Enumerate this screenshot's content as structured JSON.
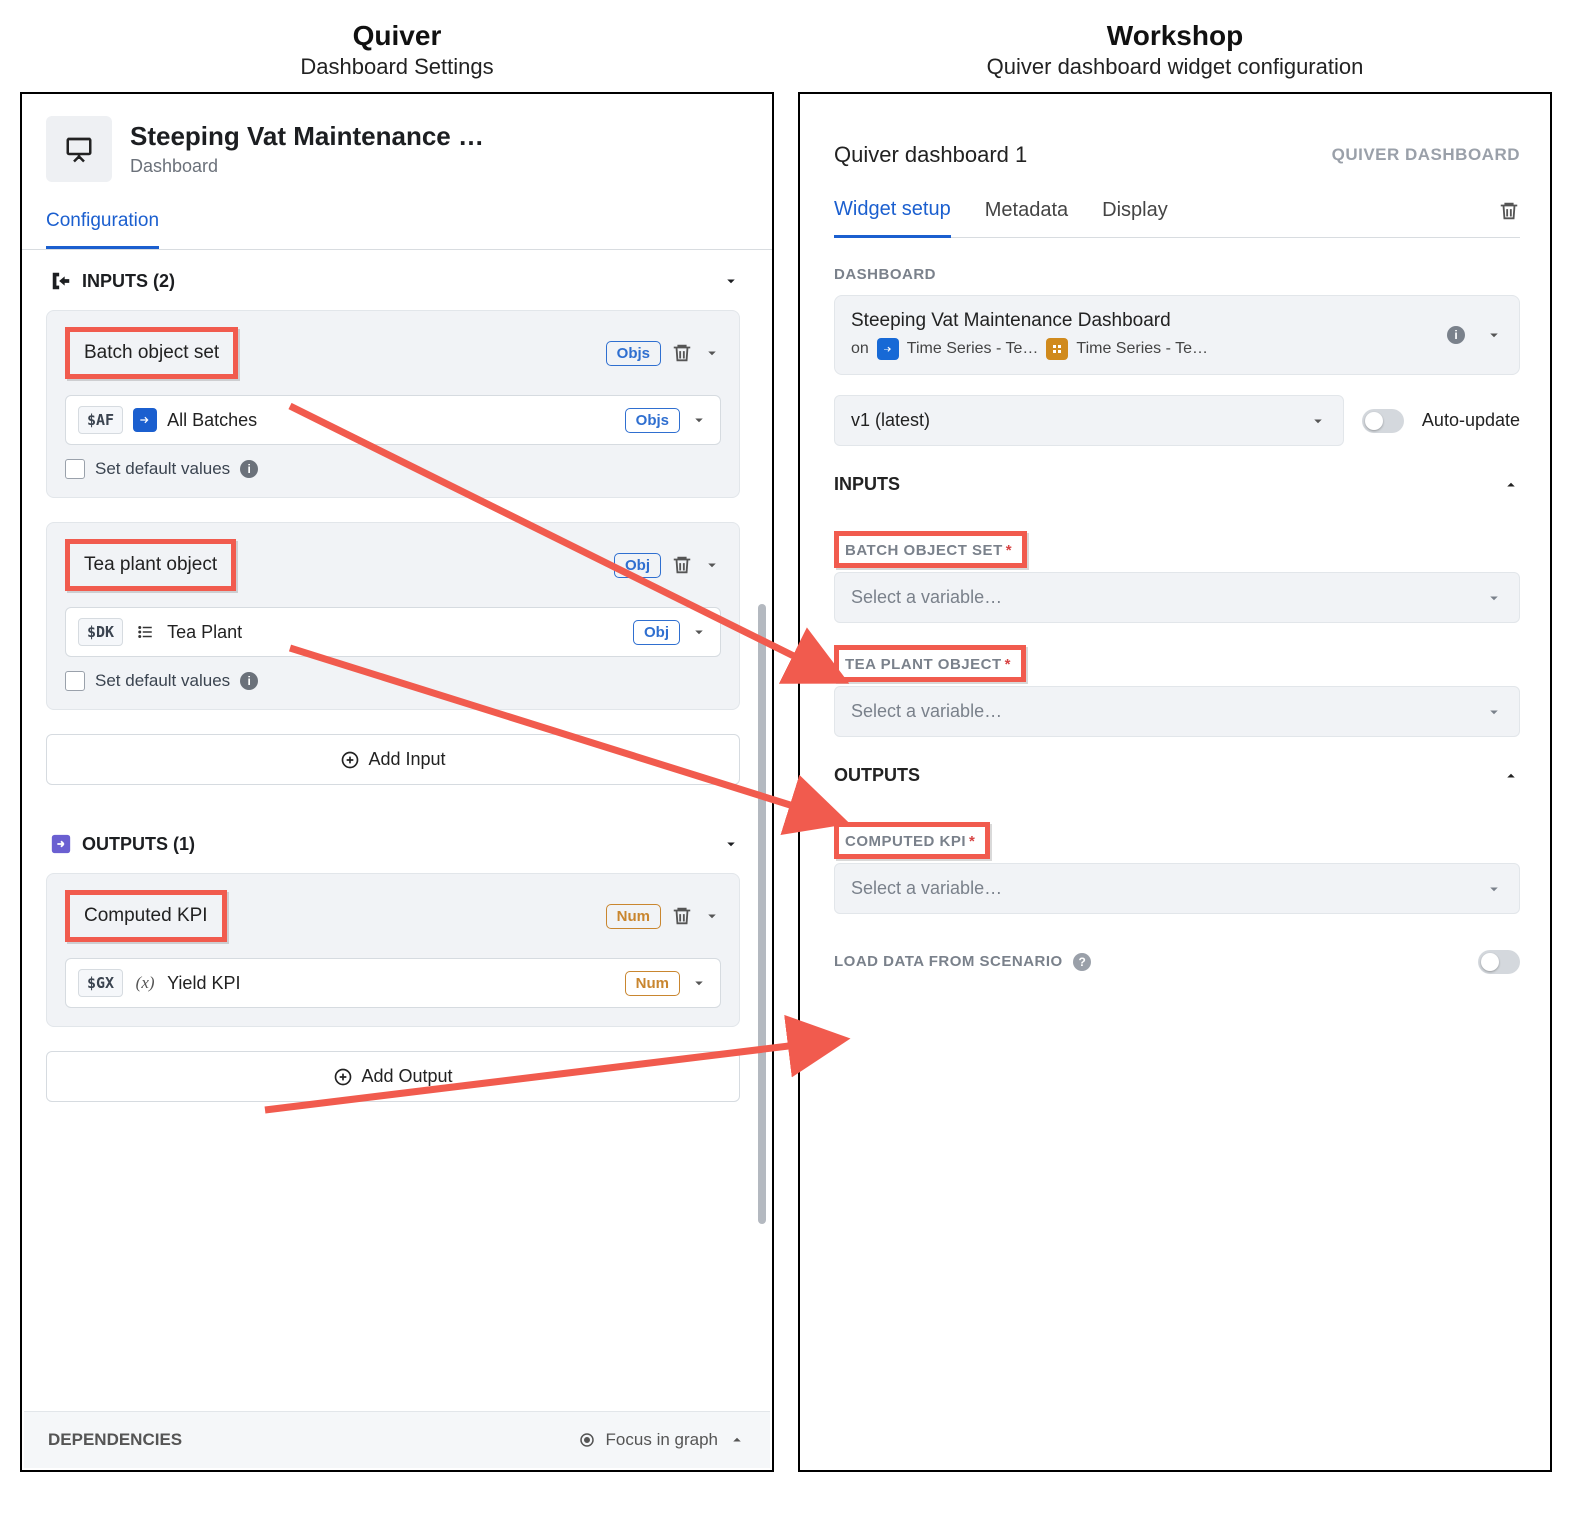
{
  "left": {
    "heading_app": "Quiver",
    "heading_sub": "Dashboard Settings",
    "dashboard_title": "Steeping Vat Maintenance …",
    "dashboard_type": "Dashboard",
    "tab_configuration": "Configuration",
    "inputs_header": "INPUTS (2)",
    "outputs_header": "OUTPUTS (1)",
    "inputs": [
      {
        "title": "Batch object set",
        "type_tag": "Objs",
        "var_code": "$AF",
        "var_icon": "arrow",
        "var_label": "All Batches",
        "value_type_tag": "Objs",
        "set_default_label": "Set default values"
      },
      {
        "title": "Tea plant object",
        "type_tag": "Obj",
        "var_code": "$DK",
        "var_icon": "list",
        "var_label": "Tea Plant",
        "value_type_tag": "Obj",
        "set_default_label": "Set default values"
      }
    ],
    "add_input_label": "Add Input",
    "outputs": [
      {
        "title": "Computed KPI",
        "type_tag": "Num",
        "var_code": "$GX",
        "var_icon": "fx",
        "var_label": "Yield KPI",
        "value_type_tag": "Num"
      }
    ],
    "add_output_label": "Add Output",
    "dependencies_label": "DEPENDENCIES",
    "focus_in_graph": "Focus in graph"
  },
  "right": {
    "heading_app": "Workshop",
    "heading_sub": "Quiver dashboard widget configuration",
    "widget_title": "Quiver dashboard 1",
    "widget_type": "QUIVER DASHBOARD",
    "tabs": {
      "setup": "Widget setup",
      "metadata": "Metadata",
      "display": "Display"
    },
    "dashboard_section": "DASHBOARD",
    "dashboard_name": "Steeping Vat Maintenance Dashboard",
    "dashboard_on": "on",
    "series1": "Time Series - Te…",
    "series2": "Time Series - Te…",
    "version_value": "v1 (latest)",
    "auto_update": "Auto-update",
    "inputs_header": "INPUTS",
    "input_labels": [
      {
        "label": "BATCH OBJECT SET",
        "placeholder": "Select a variable…"
      },
      {
        "label": "TEA PLANT OBJECT",
        "placeholder": "Select a variable…"
      }
    ],
    "outputs_header": "OUTPUTS",
    "output_labels": [
      {
        "label": "COMPUTED KPI",
        "placeholder": "Select a variable…"
      }
    ],
    "scenario_label": "LOAD DATA FROM SCENARIO"
  }
}
